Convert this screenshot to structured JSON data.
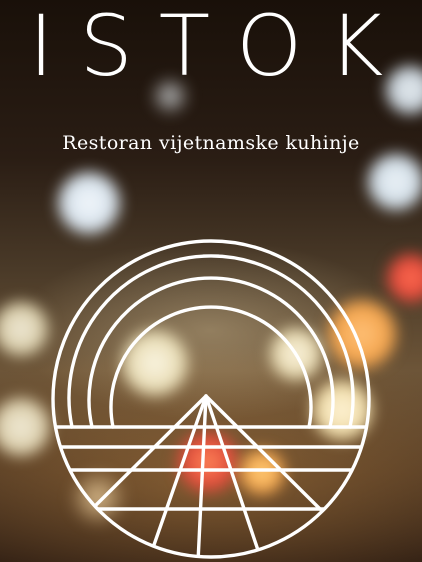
{
  "brand": {
    "name": "ISTOK",
    "tagline": "Restoran vijetnamske kuhinje"
  },
  "logo": {
    "icon": "sunrise-mountain-emblem-icon",
    "color": "#ffffff"
  },
  "colors": {
    "text": "#ffffff",
    "background_dark": "#1e140e",
    "background_warm": "#6d5538",
    "light_spot_red": "#e0483a",
    "light_spot_orange": "#f4a44c",
    "light_spot_cool": "#dfe8f0"
  }
}
